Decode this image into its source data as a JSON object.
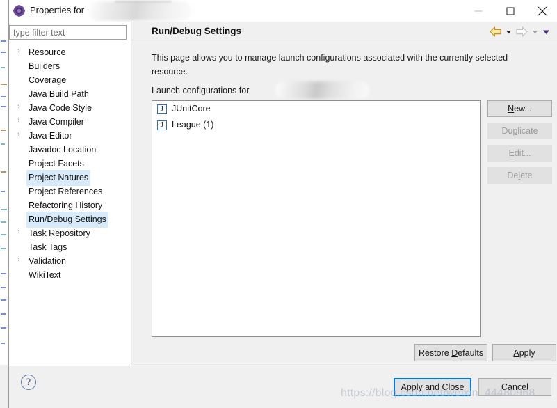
{
  "window": {
    "title_prefix": "Properties for",
    "title_redacted": "",
    "app_icon": "eclipse-properties-icon",
    "controls": {
      "minimize": "minimize-icon",
      "maximize": "maximize-icon",
      "close": "close-icon"
    }
  },
  "sidebar": {
    "filter": {
      "placeholder": "type filter text",
      "value": ""
    },
    "items": [
      {
        "label": "Resource",
        "expandable": true,
        "selected": false
      },
      {
        "label": "Builders",
        "expandable": false,
        "selected": false
      },
      {
        "label": "Coverage",
        "expandable": false,
        "selected": false
      },
      {
        "label": "Java Build Path",
        "expandable": false,
        "selected": false
      },
      {
        "label": "Java Code Style",
        "expandable": true,
        "selected": false
      },
      {
        "label": "Java Compiler",
        "expandable": true,
        "selected": false
      },
      {
        "label": "Java Editor",
        "expandable": true,
        "selected": false
      },
      {
        "label": "Javadoc Location",
        "expandable": false,
        "selected": false
      },
      {
        "label": "Project Facets",
        "expandable": false,
        "selected": false
      },
      {
        "label": "Project Natures",
        "expandable": false,
        "selected": true
      },
      {
        "label": "Project References",
        "expandable": false,
        "selected": false
      },
      {
        "label": "Refactoring History",
        "expandable": false,
        "selected": false
      },
      {
        "label": "Run/Debug Settings",
        "expandable": false,
        "selected": true
      },
      {
        "label": "Task Repository",
        "expandable": true,
        "selected": false
      },
      {
        "label": "Task Tags",
        "expandable": false,
        "selected": false
      },
      {
        "label": "Validation",
        "expandable": true,
        "selected": false
      },
      {
        "label": "WikiText",
        "expandable": false,
        "selected": false
      }
    ],
    "twisty_glyph": "›"
  },
  "page": {
    "title": "Run/Debug Settings",
    "description": "This page allows you to manage launch configurations associated with the currently selected resource.",
    "launch_label": "Launch configurations for",
    "launch_label_redacted": "",
    "nav": {
      "back_icon": "back-arrow-icon",
      "back_menu_icon": "chevron-down-icon",
      "forward_icon": "forward-arrow-icon",
      "forward_menu_icon": "chevron-down-icon",
      "view_menu_icon": "chevron-down-icon"
    }
  },
  "configurations": [
    {
      "name": "JUnitCore",
      "icon": "java-launch-config-icon"
    },
    {
      "name": "League (1)",
      "icon": "java-launch-config-icon"
    }
  ],
  "side_buttons": [
    {
      "label": "New...",
      "mnemonic": "N",
      "enabled": true
    },
    {
      "label": "Duplicate",
      "mnemonic": "p",
      "enabled": false
    },
    {
      "label": "Edit...",
      "mnemonic": "E",
      "enabled": false
    },
    {
      "label": "Delete",
      "mnemonic": "l",
      "enabled": false
    }
  ],
  "page_buttons": {
    "restore_defaults": {
      "label": "Restore Defaults",
      "mnemonic": "D"
    },
    "apply": {
      "label": "Apply",
      "mnemonic": "A"
    }
  },
  "footer": {
    "help_icon": "help-question-icon",
    "apply_and_close": {
      "label": "Apply and Close",
      "focused": true
    },
    "cancel": {
      "label": "Cancel"
    }
  },
  "watermark": "https://blog.csdn.net/weixin_44480968",
  "colors": {
    "accent_focus": "#0078d7",
    "selection": "#d7ebfb",
    "chrome": "#f0f0f0",
    "back_arrow": "#e6a817",
    "forward_arrow": "#c9c9c9"
  }
}
